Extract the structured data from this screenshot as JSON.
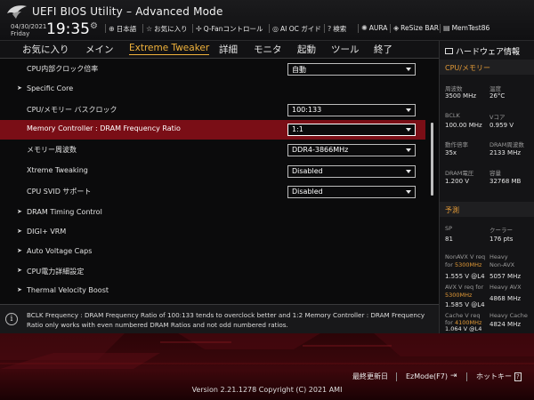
{
  "header": {
    "title": "UEFI BIOS Utility – Advanced Mode",
    "date": "04/30/2021",
    "day": "Friday",
    "time": "19:35",
    "items": [
      {
        "icon": "globe-icon",
        "label": "日本語"
      },
      {
        "icon": "star-icon",
        "label": "お気に入り"
      },
      {
        "icon": "fan-icon",
        "label": "Q-Fanコントロール"
      },
      {
        "icon": "ai-oc-icon",
        "label": "AI OC ガイド"
      },
      {
        "icon": "help-icon",
        "label": "検索"
      },
      {
        "icon": "aura-icon",
        "label": "AURA"
      },
      {
        "icon": "resize-bar-icon",
        "label": "ReSize BAR"
      },
      {
        "icon": "memtest-icon",
        "label": "MemTest86"
      }
    ]
  },
  "menu": {
    "tabs": [
      "お気に入り",
      "メイン",
      "Extreme Tweaker",
      "詳細",
      "モニタ",
      "起動",
      "ツール",
      "終了"
    ],
    "active": "Extreme Tweaker"
  },
  "settings": [
    {
      "label": "CPU内部クロック倍率",
      "value": "自動",
      "type": "dropdown"
    },
    {
      "label": "Specific Core",
      "type": "submenu"
    },
    {
      "label": "CPU/メモリー バスクロック",
      "value": "100:133",
      "type": "dropdown"
    },
    {
      "label": "Memory Controller : DRAM Frequency Ratio",
      "value": "1:1",
      "type": "dropdown",
      "selected": true
    },
    {
      "label": "メモリー周波数",
      "value": "DDR4-3866MHz",
      "type": "dropdown"
    },
    {
      "label": "Xtreme Tweaking",
      "value": "Disabled",
      "type": "dropdown"
    },
    {
      "label": "CPU SVID サポート",
      "value": "Disabled",
      "type": "dropdown"
    },
    {
      "label": "DRAM Timing Control",
      "type": "submenu"
    },
    {
      "label": "DIGI+ VRM",
      "type": "submenu"
    },
    {
      "label": "Auto Voltage Caps",
      "type": "submenu"
    },
    {
      "label": "CPU電力詳細設定",
      "type": "submenu"
    },
    {
      "label": "Thermal Velocity Boost",
      "type": "submenu"
    }
  ],
  "description": "BCLK Frequency : DRAM Frequency Ratio of 100:133 tends to overclock better and 1:2 Memory Controller : DRAM Frequency Ratio only works with even numbered DRAM Ratios and not odd numbered ratios.",
  "hardware": {
    "title": "ハードウェア情報",
    "cpu_section": "CPU/メモリー",
    "cpu": [
      {
        "k1": "周波数",
        "v1": "3500 MHz",
        "k2": "温度",
        "v2": "26°C"
      },
      {
        "k1": "BCLK",
        "v1": "100.00 MHz",
        "k2": "Vコア",
        "v2": "0.959 V"
      },
      {
        "k1": "動作倍率",
        "v1": "35x",
        "k2": "DRAM周波数",
        "v2": "2133 MHz"
      },
      {
        "k1": "DRAM電圧",
        "v1": "1.200 V",
        "k2": "容量",
        "v2": "32768 MB"
      }
    ],
    "pred_section": "予測",
    "pred": {
      "sp_label": "SP",
      "sp_value": "81",
      "cooler_label": "クーラー",
      "cooler_value": "176 pts",
      "nonavx_label": "NonAVX V req",
      "nonavx_for": "for",
      "nonavx_freq": "5300MHz",
      "nonavx_v": "1.555 V @L4",
      "heavy_nonavx_label1": "Heavy",
      "heavy_nonavx_label2": "Non-AVX",
      "heavy_nonavx_v": "5057 MHz",
      "avx_label": "AVX V req",
      "avx_for": "for",
      "avx_freq": "5300MHz",
      "avx_v": "1.585 V @L4",
      "heavy_avx_label": "Heavy AVX",
      "heavy_avx_v": "4868 MHz",
      "cache_label": "Cache V req",
      "cache_for": "for",
      "cache_freq": "4100MHz",
      "cache_v": "1.064 V @L4",
      "heavy_cache_label": "Heavy Cache",
      "heavy_cache_v": "4824 MHz"
    }
  },
  "footer": {
    "last_modified": "最終更新日",
    "ezmode": "EzMode(F7)",
    "hotkey": "ホットキー",
    "hotkey_icon": "?",
    "version": "Version 2.21.1278 Copyright (C) 2021 AMI"
  },
  "colors": {
    "accent": "#f0b23c",
    "selected_row": "#7a0e16",
    "hw_section": "#e39a37"
  }
}
